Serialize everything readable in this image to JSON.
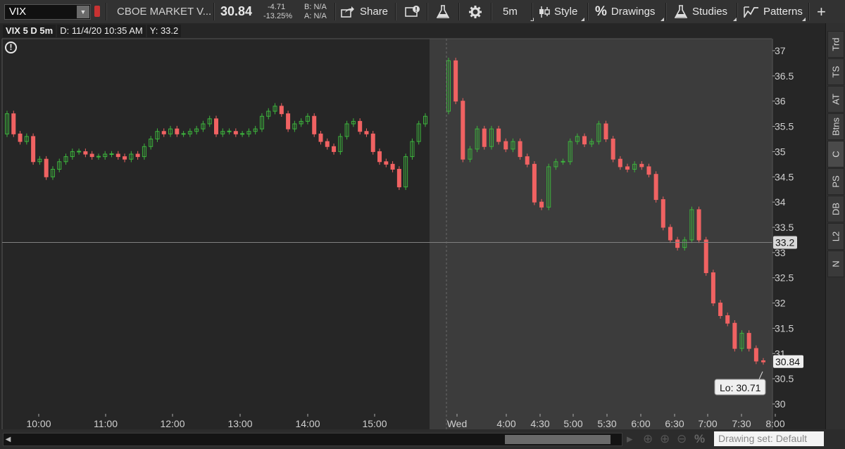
{
  "toolbar": {
    "symbol": "VIX",
    "description": "CBOE MARKET V...",
    "last": "30.84",
    "net_change": "-4.71",
    "pct_change": "-13.25%",
    "bid": "B: N/A",
    "ask": "A: N/A",
    "share_label": "Share",
    "timeframe": "5m",
    "style_label": "Style",
    "drawings_label": "Drawings",
    "studies_label": "Studies",
    "patterns_label": "Patterns"
  },
  "info": {
    "title": "VIX 5 D 5m",
    "date": "D: 11/4/20 10:35 AM",
    "yval": "Y: 33.2"
  },
  "side_tabs": [
    "Trd",
    "TS",
    "AT",
    "Btns",
    "C",
    "PS",
    "DB",
    "L2",
    "N"
  ],
  "bottom": {
    "drawing_set": "Drawing set: Default"
  },
  "colors": {
    "up": "#3db53d",
    "down": "#f06262",
    "background": "#262626",
    "extended_session": "#3c3c3c",
    "crosshair": "#808080"
  },
  "chart_data": {
    "type": "candlestick",
    "symbol": "VIX",
    "y_ticks": [
      "37",
      "36.5",
      "36",
      "35.5",
      "35",
      "34.5",
      "34",
      "33.5",
      "33",
      "32.5",
      "32",
      "31.5",
      "31",
      "30.5",
      "30"
    ],
    "ylim": [
      30,
      37.2
    ],
    "x_ticks": [
      "10:00",
      "11:00",
      "12:00",
      "13:00",
      "14:00",
      "15:00",
      "Wed",
      "4:00",
      "4:30",
      "5:00",
      "5:30",
      "6:00",
      "6:30",
      "7:00",
      "7:30",
      "8:00"
    ],
    "crosshair_y": 33.2,
    "crosshair_label": "33.2",
    "last_price": 30.84,
    "last_price_label": "30.84",
    "low_label": "Lo: 30.71",
    "day1_closes": [
      35.75,
      35.35,
      35.2,
      35.3,
      34.8,
      34.85,
      34.5,
      34.65,
      34.8,
      34.9,
      35.0,
      35.0,
      34.95,
      34.9,
      34.9,
      34.95,
      34.95,
      34.9,
      34.85,
      34.95,
      34.9,
      35.1,
      35.25,
      35.4,
      35.35,
      35.45,
      35.35,
      35.35,
      35.4,
      35.45,
      35.55,
      35.65,
      35.35,
      35.4,
      35.4,
      35.35,
      35.35,
      35.4,
      35.45,
      35.7,
      35.8,
      35.9,
      35.75,
      35.45,
      35.55,
      35.6,
      35.7,
      35.35,
      35.2,
      35.1,
      35.0,
      35.3,
      35.55,
      35.6,
      35.4,
      35.35,
      35.0,
      34.8,
      34.75,
      34.65,
      34.3,
      34.9,
      35.2,
      35.55,
      35.7
    ],
    "day2_closes": [
      36.8,
      36.0,
      34.85,
      35.05,
      35.45,
      35.1,
      35.45,
      35.2,
      35.05,
      35.2,
      34.9,
      34.75,
      34.0,
      33.9,
      34.7,
      34.8,
      34.8,
      35.2,
      35.3,
      35.15,
      35.2,
      35.55,
      35.25,
      34.85,
      34.7,
      34.65,
      34.75,
      34.7,
      34.55,
      34.05,
      33.5,
      33.25,
      33.1,
      33.25,
      33.85,
      33.25,
      32.6,
      32.0,
      31.75,
      31.6,
      31.1,
      31.4,
      31.1,
      30.85,
      30.84
    ]
  }
}
